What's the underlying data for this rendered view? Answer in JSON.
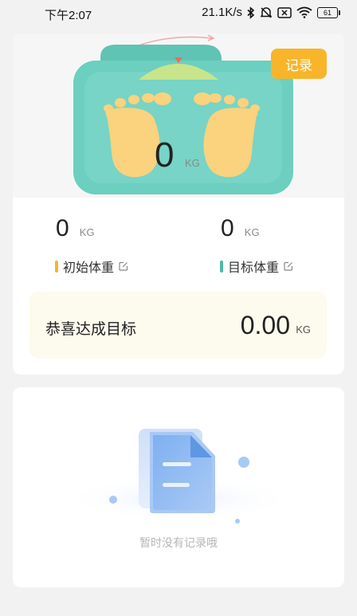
{
  "status_bar": {
    "time": "下午2:07",
    "network_speed": "21.1K/s",
    "battery": "61"
  },
  "hero": {
    "current_weight": "0",
    "current_unit": "KG",
    "record_button": "记录"
  },
  "stats": {
    "initial": {
      "value": "0",
      "unit": "KG",
      "label": "初始体重",
      "bar_color": "#f8b52a"
    },
    "target": {
      "value": "0",
      "unit": "KG",
      "label": "目标体重",
      "bar_color": "#4fb8a8"
    }
  },
  "goal": {
    "label": "恭喜达成目标",
    "value": "0.00",
    "unit": "KG"
  },
  "records": {
    "empty_text": "暂时没有记录哦"
  },
  "colors": {
    "accent_orange": "#f8b52a",
    "scale_teal": "#6ccfc0",
    "foot_yellow": "#fbd27e",
    "goal_background": "#fdfaee"
  },
  "icons": [
    "bluetooth-icon",
    "mute-icon",
    "sim-icon",
    "wifi-icon",
    "battery-icon",
    "edit-icon",
    "document-icon"
  ]
}
